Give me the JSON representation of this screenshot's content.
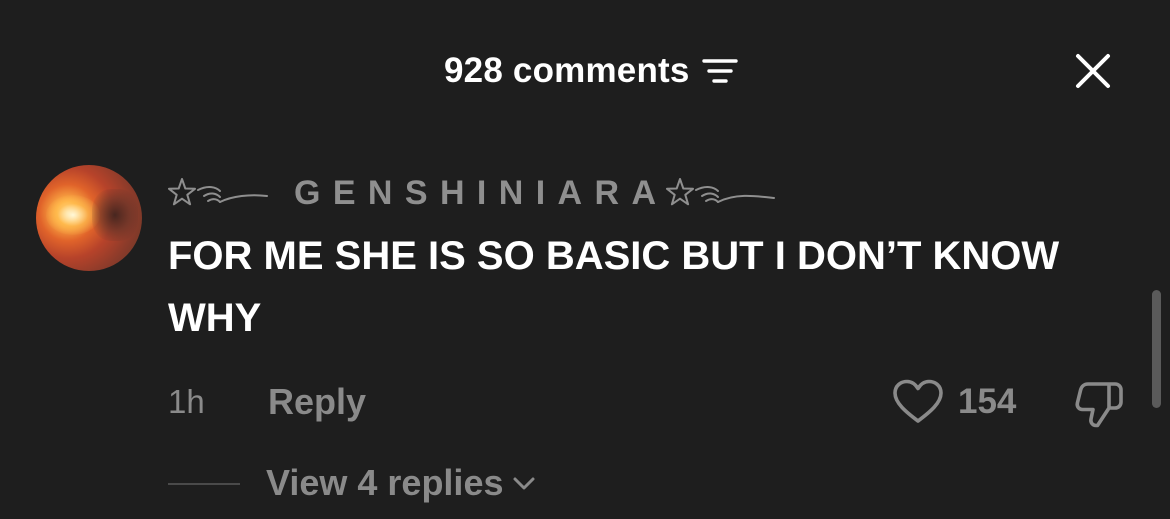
{
  "header": {
    "comments_count": "928 comments",
    "sort_icon": "filter-lines-icon",
    "close_icon": "close-icon"
  },
  "comment": {
    "username": "GENSHINIARA",
    "text": "FOR ME SHE IS SO BASIC BUT I DON’T KNOW WHY",
    "timestamp": "1h",
    "reply_label": "Reply",
    "like_count": "154",
    "like_icon": "heart-outline-icon",
    "dislike_icon": "thumbs-down-outline-icon",
    "view_replies_label": "View 4 replies",
    "view_replies_icon": "chevron-down-icon"
  },
  "colors": {
    "background": "#1e1e1e",
    "primary_text": "#ffffff",
    "secondary_text": "#8a8a8a",
    "username": "#8f8f8f"
  }
}
